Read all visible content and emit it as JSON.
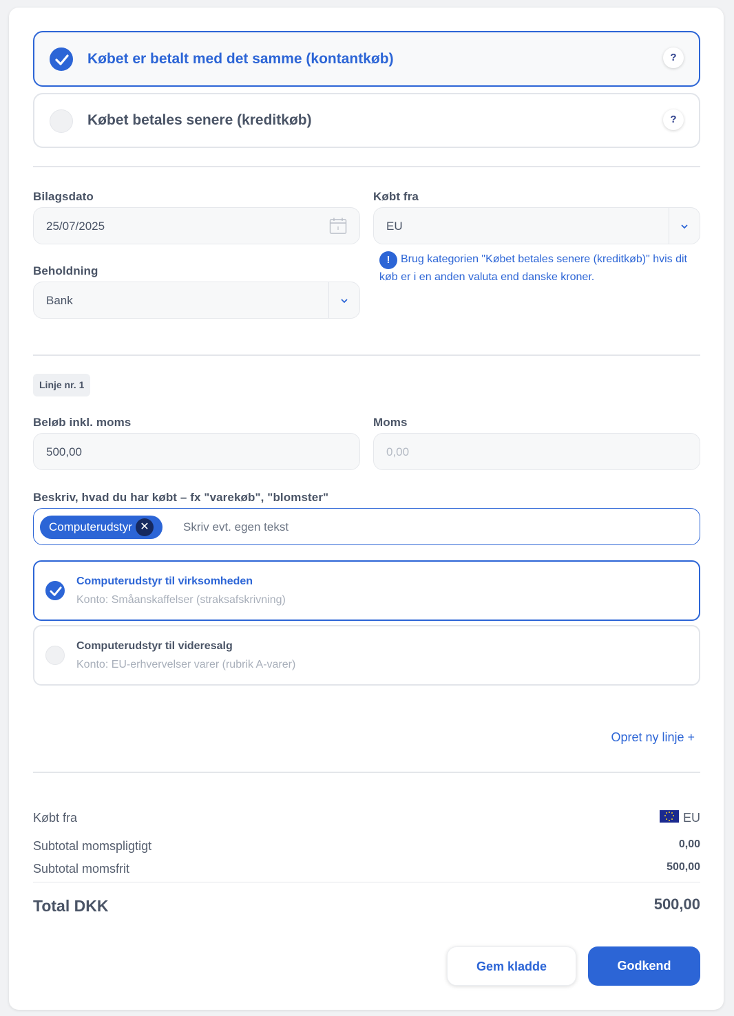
{
  "payment_options": [
    {
      "label": "Købet er betalt med det samme (kontantkøb)",
      "selected": true,
      "help": "?"
    },
    {
      "label": "Købet betales senere (kreditkøb)",
      "selected": false,
      "help": "?"
    }
  ],
  "form": {
    "bilagsdato_label": "Bilagsdato",
    "bilagsdato_value": "25/07/2025",
    "koebt_fra_label": "Købt fra",
    "koebt_fra_value": "EU",
    "info_icon": "!",
    "info_text": "Brug kategorien \"Købet betales senere (kreditkøb)\" hvis dit køb er i en anden valuta end danske kroner.",
    "beholdning_label": "Beholdning",
    "beholdning_value": "Bank"
  },
  "line": {
    "badge": "Linje nr. 1",
    "belob_label": "Beløb inkl. moms",
    "belob_value": "500,00",
    "moms_label": "Moms",
    "moms_value": "0,00",
    "describe_label": "Beskriv, hvad du har købt – fx \"varekøb\", \"blomster\"",
    "tag": "Computerudstyr",
    "tag_remove": "✕",
    "tag_placeholder": "Skriv evt. egen tekst",
    "accounts": [
      {
        "title": "Computerudstyr til virksomheden",
        "sub": "Konto: Småanskaffelser (straksafskrivning)",
        "selected": true
      },
      {
        "title": "Computerudstyr til videresalg",
        "sub": "Konto: EU-erhvervelser varer (rubrik A-varer)",
        "selected": false
      }
    ],
    "new_line": "Opret ny linje +"
  },
  "summary": {
    "koebt_fra_label": "Købt fra",
    "koebt_fra_value": "EU",
    "subtotal_moms_label": "Subtotal momspligtigt",
    "subtotal_moms_value": "0,00",
    "subtotal_fri_label": "Subtotal momsfrit",
    "subtotal_fri_value": "500,00",
    "total_label": "Total DKK",
    "total_value": "500,00"
  },
  "buttons": {
    "draft": "Gem kladde",
    "approve": "Godkend"
  },
  "colors": {
    "accent": "#2c65d6",
    "text": "#4a5466",
    "border": "#e2e5ea"
  }
}
